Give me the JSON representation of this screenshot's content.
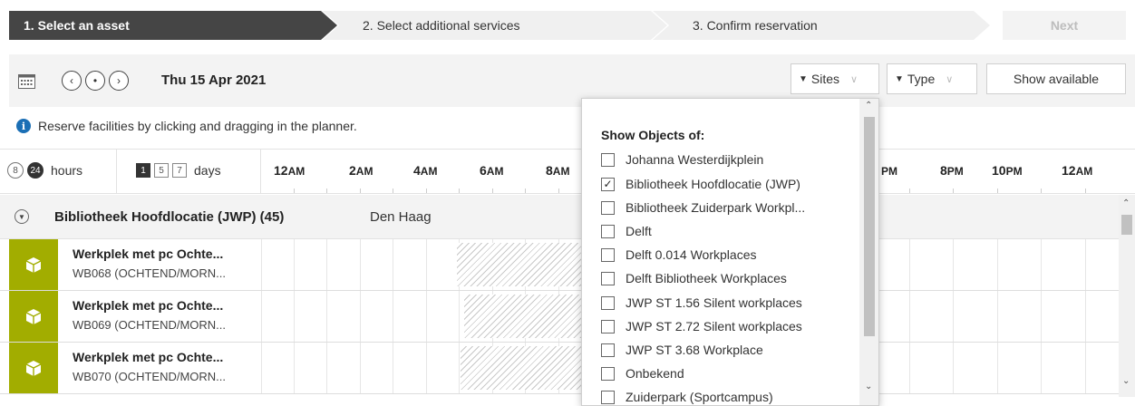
{
  "steps": {
    "step1": "1. Select an asset",
    "step2": "2. Select additional services",
    "step3": "3. Confirm reservation",
    "next": "Next"
  },
  "toolbar": {
    "date": "Thu 15 Apr 2021",
    "sites_label": "Sites",
    "type_label": "Type",
    "show_available": "Show available"
  },
  "info_text": "Reserve facilities by clicking and dragging in the planner.",
  "planner": {
    "zoom_options": [
      "8",
      "24"
    ],
    "zoom_unit": "hours",
    "day_options": [
      "1",
      "5",
      "7"
    ],
    "day_unit": "days",
    "hours": [
      {
        "num": "12",
        "ampm": "AM"
      },
      {
        "num": "2",
        "ampm": "AM"
      },
      {
        "num": "4",
        "ampm": "AM"
      },
      {
        "num": "6",
        "ampm": "AM"
      },
      {
        "num": "8",
        "ampm": "AM"
      },
      {
        "num": "",
        "ampm": "PM"
      },
      {
        "num": "8",
        "ampm": "PM"
      },
      {
        "num": "10",
        "ampm": "PM"
      },
      {
        "num": "12",
        "ampm": "AM"
      }
    ]
  },
  "group": {
    "name": "Bibliotheek Hoofdlocatie (JWP) (45)",
    "city": "Den Haag"
  },
  "rows": [
    {
      "title": "Werkplek met pc Ochte...",
      "sub": "WB068 (OCHTEND/MORN..."
    },
    {
      "title": "Werkplek met pc Ochte...",
      "sub": "WB069 (OCHTEND/MORN..."
    },
    {
      "title": "Werkplek met pc Ochte...",
      "sub": "WB070 (OCHTEND/MORN..."
    }
  ],
  "dropdown": {
    "title": "Show Objects of:",
    "items": [
      {
        "label": "Johanna Westerdijkplein",
        "checked": false
      },
      {
        "label": "Bibliotheek Hoofdlocatie (JWP)",
        "checked": true
      },
      {
        "label": "Bibliotheek Zuiderpark Workpl...",
        "checked": false
      },
      {
        "label": "Delft",
        "checked": false
      },
      {
        "label": "Delft 0.014 Workplaces",
        "checked": false
      },
      {
        "label": "Delft Bibliotheek Workplaces",
        "checked": false
      },
      {
        "label": "JWP ST 1.56 Silent workplaces",
        "checked": false
      },
      {
        "label": "JWP ST 2.72 Silent workplaces",
        "checked": false
      },
      {
        "label": "JWP ST 3.68 Workplace",
        "checked": false
      },
      {
        "label": "Onbekend",
        "checked": false
      },
      {
        "label": "Zuiderpark (Sportcampus)",
        "checked": false
      }
    ]
  },
  "colors": {
    "asset_icon_bg": "#a2ad00",
    "active_step_bg": "#454545",
    "info_icon": "#1b6fb5"
  },
  "icons": {
    "calendar": "calendar-icon",
    "prev": "chevron-left-icon",
    "today": "dot-icon",
    "next": "chevron-right-icon",
    "filter": "filter-icon",
    "info": "info-icon",
    "collapse": "collapse-icon",
    "asset": "cube-icon"
  }
}
